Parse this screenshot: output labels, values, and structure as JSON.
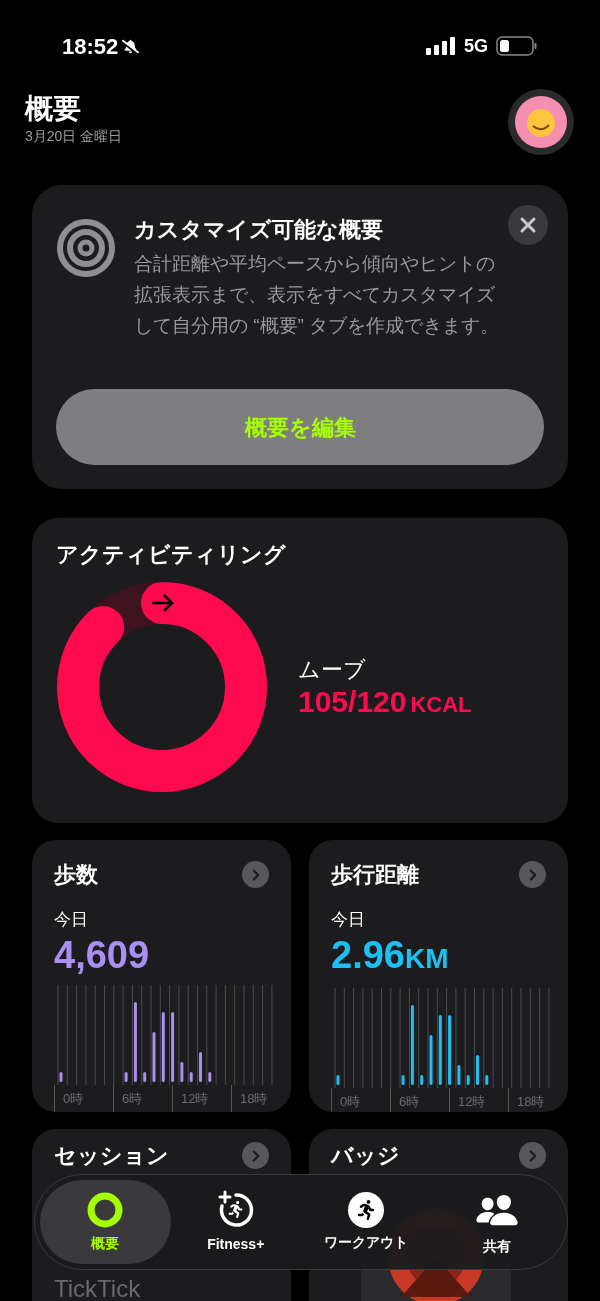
{
  "status_bar": {
    "time": "18:52",
    "silent": true,
    "network": "5G"
  },
  "header": {
    "title": "概要",
    "date": "3月20日 金曜日"
  },
  "tip_card": {
    "title": "カスタマイズ可能な概要",
    "body": "合計距離や平均ペースから傾向やヒントの拡張表示まで、表示をすべてカスタマイズして自分用の “概要” タブを作成できます。",
    "button": "概要を編集"
  },
  "activity_card": {
    "title": "アクティビティリング",
    "ring": {
      "label": "ムーブ",
      "value": "105/120",
      "unit": "KCAL",
      "level": 0.875
    }
  },
  "metric_cards": [
    {
      "title": "歩数",
      "period": "今日",
      "value": "4,609",
      "color": "#a98ff0",
      "hour_labels": [
        "0時",
        "6時",
        "12時",
        "18時"
      ]
    },
    {
      "title": "歩行距離",
      "period": "今日",
      "value": "2.96",
      "unit": "KM",
      "color": "#1ec0f2",
      "hour_labels": [
        "0時",
        "6時",
        "12時",
        "18時"
      ]
    }
  ],
  "more_cards": [
    {
      "title": "セッション",
      "caption": "TickTick"
    },
    {
      "title": "バッジ",
      "kind": "picture"
    }
  ],
  "tab_bar": [
    {
      "label": "概要",
      "kind": "ring",
      "selected": true
    },
    {
      "label": "Fitness+",
      "kind": "fitness",
      "selected": false
    },
    {
      "label": "ワークアウト",
      "kind": "workout",
      "selected": false
    },
    {
      "label": "共有",
      "kind": "sharing",
      "selected": false
    }
  ]
}
